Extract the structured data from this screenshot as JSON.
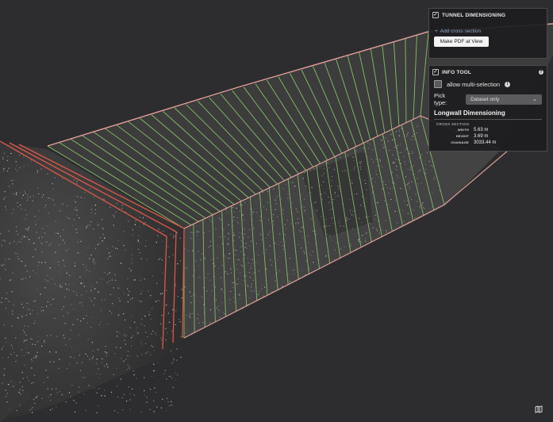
{
  "tunnel_panel": {
    "title": "TUNNEL DIMENSIONING",
    "add_link": "Add cross section",
    "pdf_button": "Make PDF at View"
  },
  "info_panel": {
    "title": "INFO TOOL",
    "multi_selection_label": "allow multi-selection",
    "pick_type_label": "Pick type:",
    "pick_type_value": "Dataset only",
    "section_title": "Longwall Dimensioning",
    "cross_section_label": "CROSS SECTION",
    "rows": [
      {
        "key": "WIDTH",
        "value": "5.63 m"
      },
      {
        "key": "HEIGHT",
        "value": "3.69 m"
      },
      {
        "key": "CHAINAGE",
        "value": "3033.44 m"
      }
    ]
  },
  "colors": {
    "background": "#2d2d2f",
    "panel": "#1e1e20",
    "green_rib": "#8fd86a",
    "red_rib": "#e05545",
    "top_edge": "#e6a09c"
  },
  "icons": [
    "checkbox-icon",
    "plus-icon",
    "help-icon",
    "info-icon",
    "chevron-down-icon",
    "map-icon"
  ]
}
